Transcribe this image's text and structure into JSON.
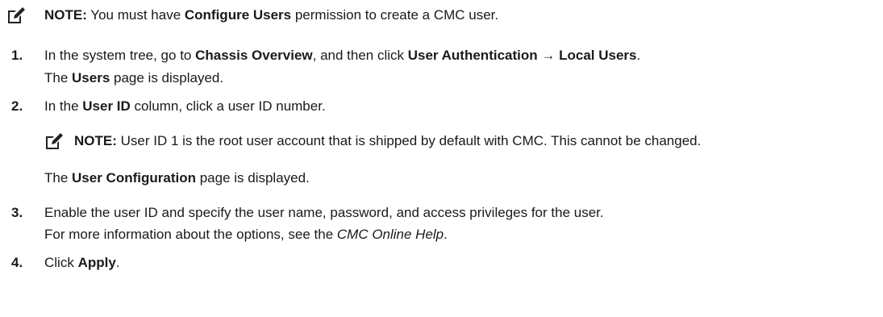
{
  "note_top": {
    "label": "NOTE:",
    "pre": " You must have ",
    "strong": "Configure Users",
    "post": " permission to create a CMC user."
  },
  "steps": [
    {
      "number": "1.",
      "line1": {
        "pre": "In the system tree, go to ",
        "b1": "Chassis Overview",
        "mid": ", and then click ",
        "b2": "User Authentication",
        "arrow": " → ",
        "b3": "Local Users",
        "end": "."
      },
      "line2": {
        "pre": "The ",
        "b": "Users",
        "post": " page is displayed."
      }
    },
    {
      "number": "2.",
      "line1": {
        "pre": "In the ",
        "b": "User ID",
        "post": " column, click a user ID number."
      },
      "note": {
        "label": "NOTE:",
        "text": " User ID 1 is the root user account that is shipped by default with CMC. This cannot be changed."
      },
      "line2": {
        "pre": "The ",
        "b": "User Configuration",
        "post": " page is displayed."
      }
    },
    {
      "number": "3.",
      "line1": "Enable the user ID and specify the user name, password, and access privileges for the user.",
      "line2": {
        "pre": "For more information about the options, see the ",
        "i": "CMC Online Help",
        "post": "."
      }
    },
    {
      "number": "4.",
      "line1": {
        "pre": "Click ",
        "b": "Apply",
        "post": "."
      }
    }
  ]
}
